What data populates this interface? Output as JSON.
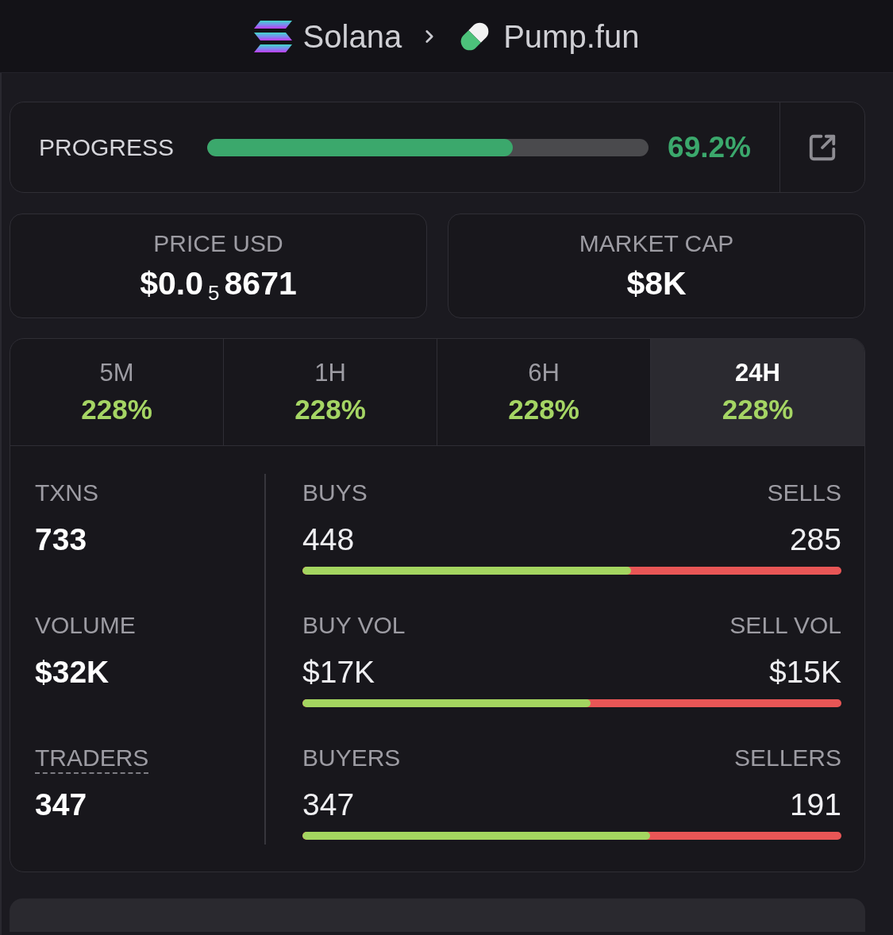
{
  "breadcrumb": [
    {
      "label": "Solana"
    },
    {
      "label": "Pump.fun"
    }
  ],
  "progress": {
    "label": "PROGRESS",
    "level": 0.692,
    "reading": "69.2%"
  },
  "summary": [
    {
      "label": "PRICE USD",
      "value": "$0.0$_{5}$8671"
    },
    {
      "label": "MARKET CAP",
      "value": "$8K"
    }
  ],
  "timeframes": [
    {
      "label": "5M",
      "change": "228%",
      "selected": false
    },
    {
      "label": "1H",
      "change": "228%",
      "selected": false
    },
    {
      "label": "6H",
      "change": "228%",
      "selected": false
    },
    {
      "label": "24H",
      "change": "228%",
      "selected": true
    }
  ],
  "totals": [
    {
      "label": "TXNS",
      "value": "733",
      "tooltip": false
    },
    {
      "label": "VOLUME",
      "value": "$32K",
      "tooltip": false
    },
    {
      "label": "TRADERS",
      "value": "347",
      "tooltip": true
    }
  ],
  "splits": [
    {
      "buy_label": "BUYS",
      "buy_value": "448",
      "sell_label": "SELLS",
      "sell_value": "285",
      "level": 0.61
    },
    {
      "buy_label": "BUY VOL",
      "buy_value": "$17K",
      "sell_label": "SELL VOL",
      "sell_value": "$15K",
      "level": 0.535
    },
    {
      "buy_label": "BUYERS",
      "buy_value": "347",
      "sell_label": "SELLERS",
      "sell_value": "191",
      "level": 0.645
    }
  ]
}
